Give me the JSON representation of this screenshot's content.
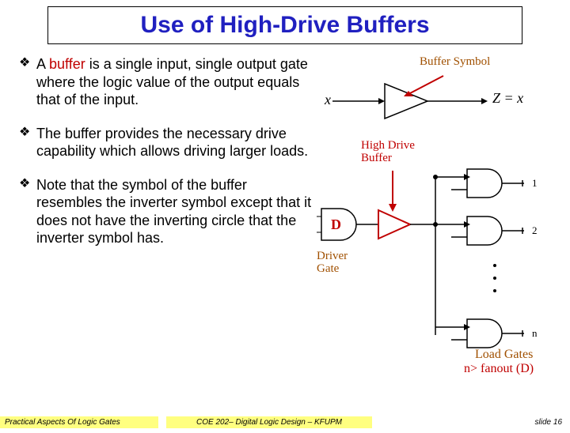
{
  "title": "Use of High-Drive Buffers",
  "bullets": [
    {
      "pre": "A ",
      "highlight": "buffer",
      "post": " is a single input, single output gate where the logic value of the output equals that of the input."
    },
    {
      "pre": "",
      "highlight": "",
      "post": "The buffer provides the necessary drive capability which allows driving larger loads."
    },
    {
      "pre": "",
      "highlight": "",
      "post": "Note that the symbol of the buffer resembles the inverter symbol except that it does not have the inverting circle that the inverter symbol has."
    }
  ],
  "diagram": {
    "buffer_symbol_label": "Buffer Symbol",
    "input_var": "x",
    "output_eq": "Z = x",
    "high_drive_label_line1": "High Drive",
    "high_drive_label_line2": "Buffer",
    "driver_gate_label_line1": "Driver",
    "driver_gate_label_line2": "Gate",
    "driver_letter": "D",
    "load_gates_label": "Load Gates",
    "fanout_label": "n> fanout (D)",
    "gate_index_1": "1",
    "gate_index_2": "2",
    "gate_index_n": "n"
  },
  "footer": {
    "left": "Practical Aspects Of Logic Gates",
    "mid": "COE 202– Digital Logic Design – KFUPM",
    "right": "slide 16"
  }
}
